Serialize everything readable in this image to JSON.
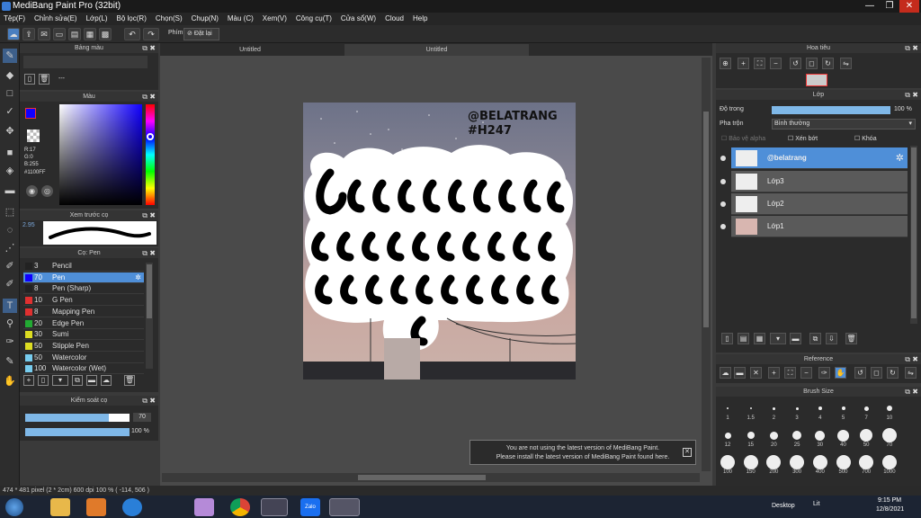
{
  "window": {
    "title": "MediBang Paint Pro (32bit)",
    "min": "—",
    "max": "❐",
    "close": "✕"
  },
  "menu": [
    "Tệp(F)",
    "Chỉnh sửa(E)",
    "Lớp(L)",
    "Bộ lọc(R)",
    "Chọn(S)",
    "Chụp(N)",
    "Màu (C)",
    "Xem(V)",
    "Công cụ(T)",
    "Cửa sổ(W)",
    "Cloud",
    "Help"
  ],
  "toolbar": {
    "keys_label": "Phím",
    "reset_label": "Đặt lại"
  },
  "panels": {
    "palette": {
      "title": "Bảng màu",
      "entry": "---"
    },
    "color": {
      "title": "Màu",
      "r": "R:17",
      "g": "G:0",
      "b": "B:255",
      "hex": "#1100FF"
    },
    "preview": {
      "title": "Xem trước cọ",
      "size": "2.95"
    },
    "brush": {
      "title": "Cọ: Pen",
      "items": [
        {
          "num": "3",
          "name": "Pencil",
          "color": "#222222"
        },
        {
          "num": "70",
          "name": "Pen",
          "color": "#1100ff",
          "selected": true
        },
        {
          "num": "8",
          "name": "Pen (Sharp)",
          "color": "#222222"
        },
        {
          "num": "10",
          "name": "G Pen",
          "color": "#e03030"
        },
        {
          "num": "8",
          "name": "Mapping Pen",
          "color": "#e03030"
        },
        {
          "num": "20",
          "name": "Edge Pen",
          "color": "#22aa33"
        },
        {
          "num": "30",
          "name": "Sumi",
          "color": "#dddd22"
        },
        {
          "num": "50",
          "name": "Stipple Pen",
          "color": "#dddd22"
        },
        {
          "num": "50",
          "name": "Watercolor",
          "color": "#77ccee"
        },
        {
          "num": "100",
          "name": "Watercolor (Wet)",
          "color": "#77ccee"
        }
      ]
    },
    "control": {
      "title": "Kiểm soát cọ",
      "size": "70",
      "opacity": "100 %"
    }
  },
  "tabs": [
    "Untitled",
    "Untitled"
  ],
  "canvas": {
    "tag1": "@BELATRANG",
    "tag2": "#H247"
  },
  "notice": {
    "line1": "You are not using the latest version of MediBang Paint.",
    "line2": "Please install the latest version of MediBang Paint found here."
  },
  "right": {
    "navigator": {
      "title": "Hoa tiêu"
    },
    "layers": {
      "title": "Lớp",
      "opacity_label": "Độ trong",
      "opacity": "100 %",
      "blend_label": "Pha trộn",
      "blend": "Bình thường",
      "protect": "Bảo vệ alpha",
      "clip": "Xén bớt",
      "lock": "Khóa",
      "items": [
        "@belatrang",
        "Lớp3",
        "Lớp2",
        "Lớp1"
      ]
    },
    "reference": {
      "title": "Reference"
    },
    "brushsize": {
      "title": "Brush Size",
      "sizes": [
        "1",
        "1.5",
        "2",
        "3",
        "4",
        "5",
        "7",
        "10",
        "12",
        "15",
        "20",
        "25",
        "30",
        "40",
        "50",
        "70",
        "100",
        "150",
        "200",
        "300",
        "400",
        "500",
        "700",
        "1000"
      ]
    }
  },
  "status": {
    "text": "474 * 481 pixel  (2 * 2cm)  600 dpi  100 %  ( -114, 506 )"
  },
  "taskbar": {
    "desktop": "Desktop",
    "time": "9:15 PM",
    "date": "12/8/2021",
    "lang": "Lit"
  }
}
